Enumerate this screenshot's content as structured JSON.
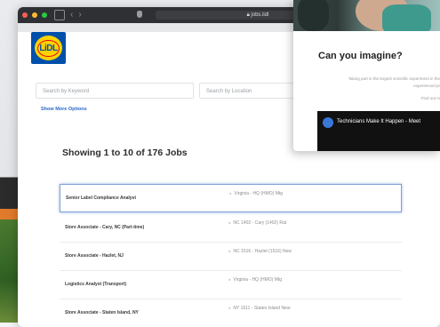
{
  "browser": {
    "url": "jobs.lidl",
    "colors": {
      "close": "#ff5f56",
      "minimize": "#ffbd2e",
      "maximize": "#27c93f"
    },
    "icons": [
      "sidebar-icon",
      "back-icon",
      "forward-icon",
      "shield-icon",
      "lock-icon"
    ]
  },
  "brand": {
    "logo_text": "LiDL",
    "colors": {
      "blue": "#0050aa",
      "yellow": "#ffd200",
      "red": "#e60a14"
    }
  },
  "search": {
    "keyword_placeholder": "Search by Keyword",
    "location_placeholder": "Search by Location",
    "more_options": "Show More Options"
  },
  "results": {
    "summary": "Showing 1 to 10 of 176 Jobs"
  },
  "jobs": [
    {
      "title": "Senior Label Compliance Analyst",
      "location": "Virginia - HQ (HMO)   Mtg"
    },
    {
      "title": "Store Associate - Cary, NC (Part-time)",
      "location": "NC 1402 - Cary (1402)   Rat"
    },
    {
      "title": "Store Associate - Hazlet, NJ",
      "location": "NC 1516 - Hazlet (1516)   New"
    },
    {
      "title": "Logistics Analyst (Transport)",
      "location": "Virginia - HQ (HMO)   Mtg"
    },
    {
      "title": "Store Associate - Staten Island, NY",
      "location": "NY 1611 - Staten Island New"
    }
  ],
  "popup": {
    "heading": "Can you imagine?",
    "line1": "Taking part in the largest scientific experiment in the",
    "line2": "experienced pr",
    "line3": "Find out m",
    "video_title": "Technicians Make It Happen - Meet"
  }
}
